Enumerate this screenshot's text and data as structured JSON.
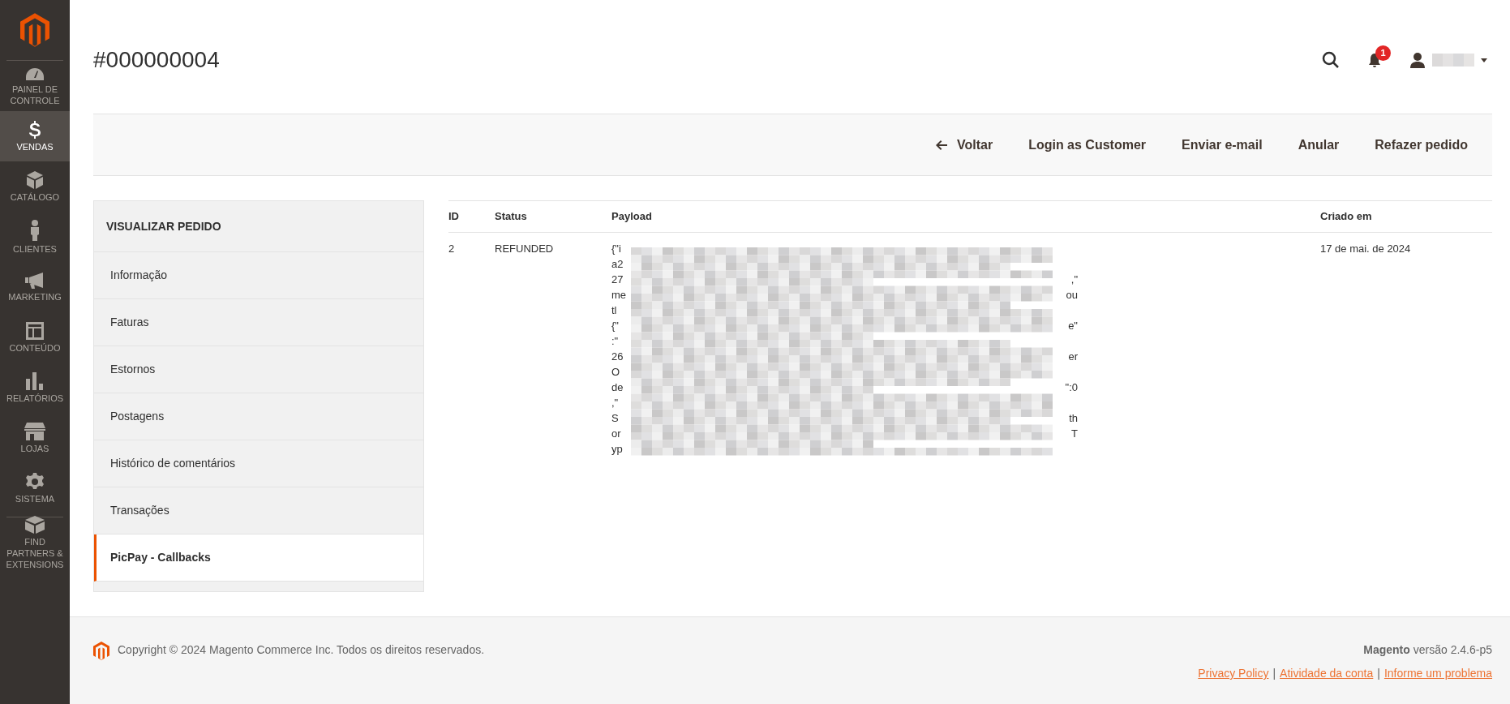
{
  "menu": [
    {
      "label": "PAINEL DE CONTROLE",
      "selected": false
    },
    {
      "label": "VENDAS",
      "selected": true
    },
    {
      "label": "CATÁLOGO",
      "selected": false
    },
    {
      "label": "CLIENTES",
      "selected": false
    },
    {
      "label": "MARKETING",
      "selected": false
    },
    {
      "label": "CONTEÚDO",
      "selected": false
    },
    {
      "label": "RELATÓRIOS",
      "selected": false
    },
    {
      "label": "LOJAS",
      "selected": false
    },
    {
      "label": "SISTEMA",
      "selected": false
    },
    {
      "label": "FIND PARTNERS & EXTENSIONS",
      "selected": false,
      "divider_before": true
    }
  ],
  "page_title": "#000000004",
  "header": {
    "notifications": "1"
  },
  "actions": [
    {
      "label": "Voltar",
      "kind": "back"
    },
    {
      "label": "Login as Customer",
      "kind": "plain"
    },
    {
      "label": "Enviar e-mail",
      "kind": "plain"
    },
    {
      "label": "Anular",
      "kind": "plain"
    },
    {
      "label": "Refazer pedido",
      "kind": "plain"
    }
  ],
  "order_nav": {
    "title": "VISUALIZAR PEDIDO",
    "items": [
      {
        "label": "Informação",
        "selected": false
      },
      {
        "label": "Faturas",
        "selected": false
      },
      {
        "label": "Estornos",
        "selected": false
      },
      {
        "label": "Postagens",
        "selected": false
      },
      {
        "label": "Histórico de comentários",
        "selected": false
      },
      {
        "label": "Transações",
        "selected": false
      },
      {
        "label": "PicPay - Callbacks",
        "selected": true
      }
    ]
  },
  "table": {
    "columns": [
      "ID",
      "Status",
      "Payload",
      "Criado em"
    ],
    "rows": [
      {
        "id": "2",
        "status": "REFUNDED",
        "created": "17 de mai. de 2024",
        "payload_lines": [
          {
            "start": "{\"i"
          },
          {
            "start": "a2"
          },
          {
            "start": "27",
            "end": ",\""
          },
          {
            "start": "me",
            "end": "ou"
          },
          {
            "start": "tl"
          },
          {
            "start": "{\"",
            "end": "e\""
          },
          {
            "start": ":\""
          },
          {
            "start": "26",
            "end": "er"
          },
          {
            "start": "O"
          },
          {
            "start": "de",
            "end": "\":0"
          },
          {
            "start": ",\""
          },
          {
            "start": "S",
            "end": "th"
          },
          {
            "start": "or",
            "end": "T"
          },
          {
            "start": "yp"
          }
        ]
      }
    ]
  },
  "footer": {
    "copyright": "Copyright © 2024 Magento Commerce Inc. Todos os direitos reservados.",
    "brand": "Magento",
    "version": "versão 2.4.6-p5",
    "links": [
      {
        "label": "Privacy Policy"
      },
      {
        "separator": "|",
        "label": "Atividade da conta"
      },
      {
        "separator": "|",
        "label": "Informe um problema"
      }
    ]
  }
}
